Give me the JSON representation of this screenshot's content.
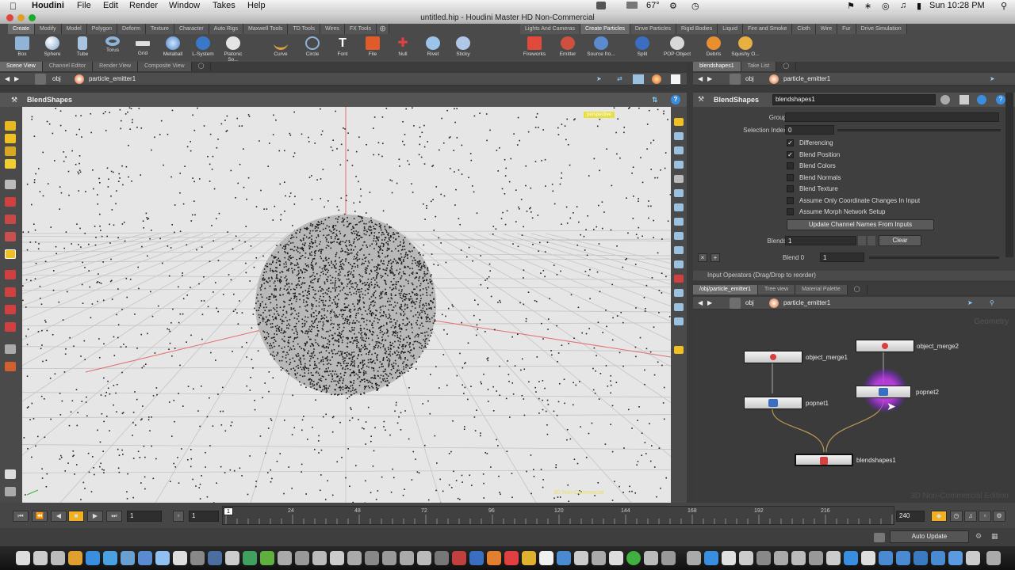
{
  "mac_menu": {
    "app": "Houdini",
    "items": [
      "File",
      "Edit",
      "Render",
      "Window",
      "Takes",
      "Help"
    ],
    "temp": "67°",
    "clock": "Sun 10:28 PM"
  },
  "window": {
    "title": "untitled.hip - Houdini Master HD Non-Commercial"
  },
  "shelf_left": {
    "tabs": [
      "Create",
      "Modify",
      "Model",
      "Polygon",
      "Deform",
      "Texture",
      "Character",
      "Auto Rigs",
      "Maxwell Tools",
      "TD Tools",
      "Wires",
      "FX Tools"
    ],
    "tools": [
      "Box",
      "Sphere",
      "Tube",
      "Torus",
      "Grid",
      "Metaball",
      "L-System",
      "Platonic So...",
      "Curve",
      "Circle",
      "Font",
      "File",
      "Null",
      "Rivet",
      "Sticky"
    ]
  },
  "shelf_right": {
    "tabs": [
      "Lights And Cameras",
      "Create Particles",
      "Drive Particles",
      "Rigid Bodies",
      "Liquid",
      "Fire and Smoke",
      "Cloth",
      "Wire",
      "Fur",
      "Drive Simulation"
    ],
    "tools": [
      "Fireworks",
      "Emitter",
      "Source fro...",
      "Split",
      "POP Object",
      "Debris",
      "Squishy O..."
    ]
  },
  "viewer": {
    "tabs": [
      "Scene View",
      "Channel Editor",
      "Render View",
      "Composite View"
    ],
    "path": [
      "obj",
      "particle_emitter1"
    ],
    "title": "BlendShapes",
    "badge": "perspective",
    "corner_text": "3D Non-Commercial"
  },
  "timeline": {
    "current_frame": "1",
    "start_frame": "1",
    "end_frame": "240",
    "ticks": [
      "1",
      "24",
      "48",
      "72",
      "96",
      "120",
      "144",
      "168",
      "192",
      "216"
    ],
    "auto_update": "Auto Update"
  },
  "params": {
    "tabs": [
      "blendshapes1",
      "Take List"
    ],
    "path": [
      "obj",
      "particle_emitter1"
    ],
    "op_type": "BlendShapes",
    "op_name": "blendshapes1",
    "group_label": "Group",
    "selection_index_label": "Selection Index",
    "selection_index_value": "0",
    "checkboxes": [
      {
        "label": "Differencing",
        "checked": true
      },
      {
        "label": "Blend Position",
        "checked": true
      },
      {
        "label": "Blend Colors",
        "checked": false
      },
      {
        "label": "Blend Normals",
        "checked": false
      },
      {
        "label": "Blend Texture",
        "checked": false
      },
      {
        "label": "Assume Only Coordinate Changes In Input",
        "checked": false
      },
      {
        "label": "Assume Morph Network Setup",
        "checked": false
      }
    ],
    "update_button": "Update Channel Names From Inputs",
    "blends_label": "Blends",
    "blends_value": "1",
    "clear_button": "Clear",
    "blend0_label": "Blend 0",
    "blend0_value": "1",
    "input_ops": "Input Operators (Drag/Drop to reorder)"
  },
  "network": {
    "tabs": [
      "/obj/particle_emitter1",
      "Tree view",
      "Material Palette"
    ],
    "path": [
      "obj",
      "particle_emitter1"
    ],
    "watermark_top": "Geometry",
    "watermark_bottom": "3D Non-Commercial Edition",
    "nodes": {
      "object_merge1": "object_merge1",
      "object_merge2": "object_merge2",
      "popnet1": "popnet1",
      "popnet2": "popnet2",
      "blendshapes1": "blendshapes1"
    }
  }
}
